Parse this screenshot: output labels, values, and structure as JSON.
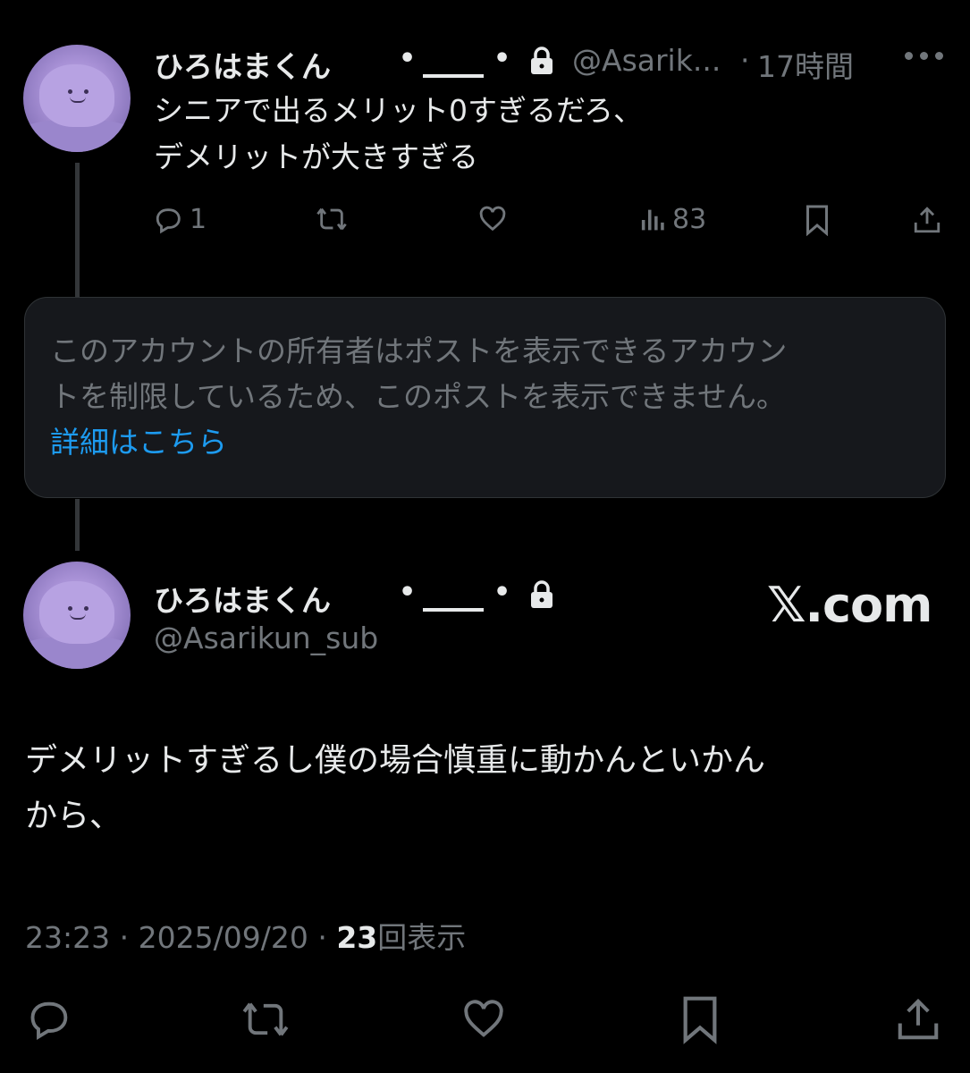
{
  "post1": {
    "display_name": "ひろはまくん",
    "handle": "@Asarik...",
    "time": "17時間",
    "separator": "·",
    "text_line1": "シニアで出るメリット0すぎるだろ、",
    "text_line2": "デメリットが大きすぎる",
    "reply_count": "1",
    "views_count": "83"
  },
  "notice": {
    "text_line1": "このアカウントの所有者はポストを表示できるアカウン",
    "text_line2": "トを制限しているため、このポストを表示できません。",
    "link": "詳細はこちら"
  },
  "post2": {
    "display_name": "ひろはまくん",
    "handle": "@Asarikun_sub",
    "brand": "𝕏.com",
    "text_line1": "デメリットすぎるし僕の場合慎重に動かんといかん",
    "text_line2": "から、",
    "time": "23:23",
    "date": "2025/09/20",
    "separator": "·",
    "views_count": "23",
    "views_label": "回表示"
  },
  "icons": [
    "reply-icon",
    "retweet-icon",
    "like-icon",
    "views-icon",
    "bookmark-icon",
    "share-icon",
    "lock-icon",
    "more-icon"
  ],
  "colors": {
    "background": "#000000",
    "text": "#e7e9ea",
    "muted": "#71767b",
    "link": "#1d9bf0"
  }
}
